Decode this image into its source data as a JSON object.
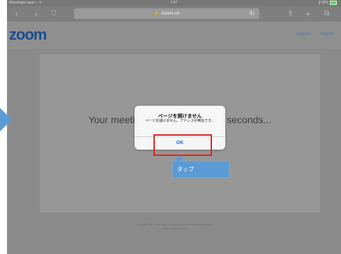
{
  "statusbar": {
    "carrier": "Messenger ●●●○○ ᯤ",
    "time": "7:47",
    "battery": "∦ 96%"
  },
  "toolbar": {
    "url": "zoom.us"
  },
  "site": {
    "logo": "zoom",
    "nav": [
      "Support",
      "English"
    ]
  },
  "main": {
    "meeting_text_start": "Your meeti",
    "meeting_text_end": "seconds...",
    "footer_line1": "Copyright ©2017 Zoom Video Communications, Inc. All rights reserved.",
    "footer_line2": "Privacy Policy | Terms"
  },
  "dialog": {
    "title": "ページを開けません",
    "message": "ページを開けません。アドレスが無効です。",
    "ok_label": "OK"
  },
  "annotation": {
    "callout_text": "タップ",
    "callout_color": "#5b9bd5",
    "highlight_color": "#e22222"
  }
}
